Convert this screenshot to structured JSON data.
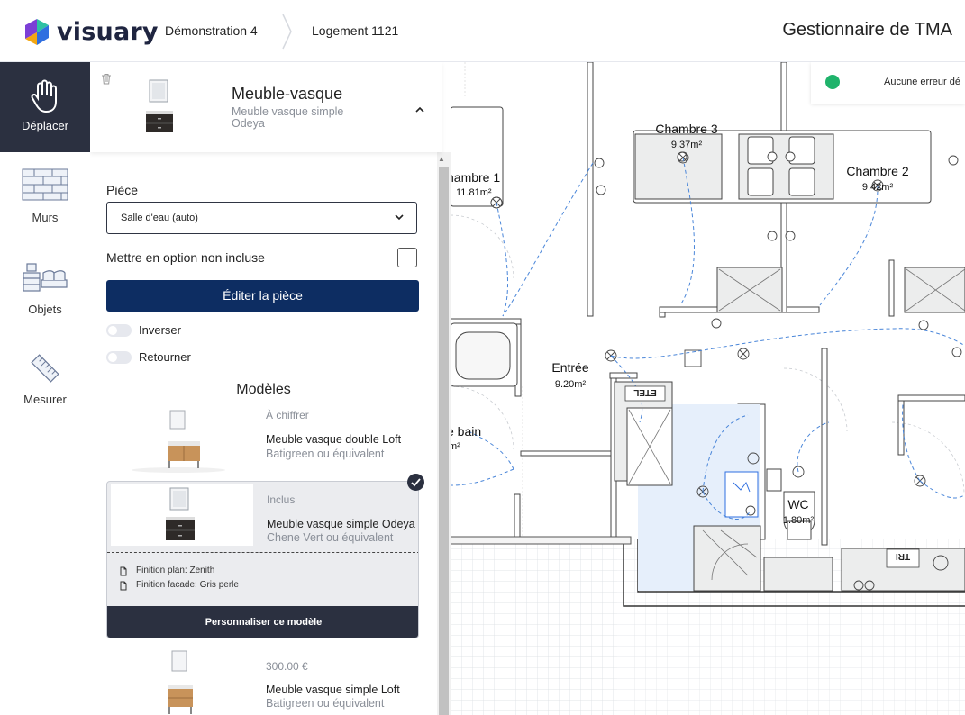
{
  "header": {
    "logo_text": "visuary",
    "breadcrumbs": [
      "Démonstration 4",
      "Logement 1121"
    ],
    "app_title": "Gestionnaire de TMA"
  },
  "rail": {
    "items": [
      {
        "label": "Déplacer",
        "icon": "hand-icon"
      },
      {
        "label": "Murs",
        "icon": "brick-wall-icon"
      },
      {
        "label": "Objets",
        "icon": "furniture-icon"
      },
      {
        "label": "Mesurer",
        "icon": "ruler-icon"
      }
    ]
  },
  "panel": {
    "object_title": "Meuble-vasque",
    "object_subtitle": "Meuble vasque simple Odeya",
    "piece_label": "Pièce",
    "piece_value": "Salle d'eau (auto)",
    "option_label": "Mettre en option non incluse",
    "edit_button": "Éditer la pièce",
    "toggle_inverser": "Inverser",
    "toggle_retourner": "Retourner",
    "models_title": "Modèles",
    "models": [
      {
        "status": "À chiffrer",
        "name": "Meuble vasque double Loft",
        "sub": "Batigreen ou équivalent"
      },
      {
        "status": "Inclus",
        "name": "Meuble vasque simple Odeya",
        "sub": "Chene Vert ou équivalent",
        "finishes": [
          "Finition plan: Zenith",
          "Finition facade: Gris perle"
        ],
        "customize": "Personnaliser ce modèle"
      },
      {
        "status": "300.00 €",
        "name": "Meuble vasque simple Loft",
        "sub": "Batigreen ou équivalent"
      }
    ]
  },
  "plan": {
    "status_text": "Aucune erreur dé",
    "rooms": [
      {
        "name": "Chambre 3",
        "area": "9.37m²"
      },
      {
        "name": "Chambre 2",
        "area": "9.42m²"
      },
      {
        "name": "hambre 1",
        "area": "11.81m²"
      },
      {
        "name": "Entrée",
        "area": "9.20m²"
      },
      {
        "name": "e bain",
        "area": "m²"
      },
      {
        "name": "WC",
        "area": "1.80m²"
      }
    ],
    "labels": [
      "ETEL",
      "TRI"
    ]
  }
}
